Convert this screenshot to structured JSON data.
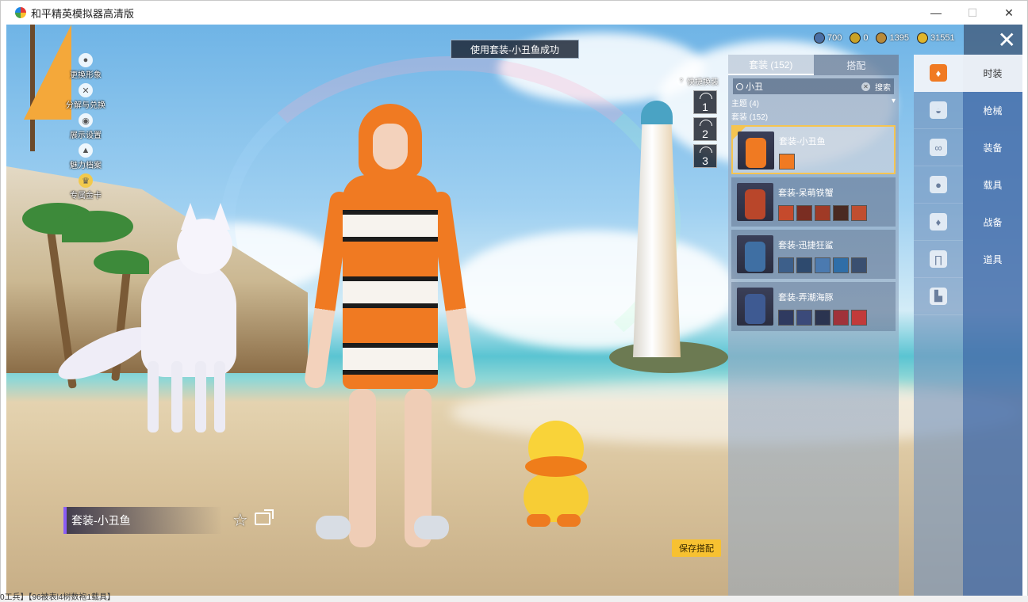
{
  "window": {
    "title": "和平精英模拟器高清版",
    "minimize": "—",
    "maximize": "☐",
    "close": "✕"
  },
  "toast": "使用套装-小丑鱼成功",
  "left_menu": [
    {
      "label": "更换形象",
      "icon": "person-icon"
    },
    {
      "label": "分解与兑换",
      "icon": "exchange-icon"
    },
    {
      "label": "展示设置",
      "icon": "eye-icon"
    },
    {
      "label": "魅力档案",
      "icon": "fire-icon"
    },
    {
      "label": "专属金卡",
      "icon": "crown-icon"
    }
  ],
  "currency": [
    {
      "value": "700",
      "color": "#4a6fa5"
    },
    {
      "value": "0",
      "color": "#c9a227"
    },
    {
      "value": "1395",
      "color": "#b88a3a"
    },
    {
      "value": "31551",
      "color": "#e0b52a"
    }
  ],
  "quick_swap": {
    "title": "快捷换装",
    "slots": [
      "1",
      "2",
      "3"
    ]
  },
  "panel": {
    "tabs": [
      {
        "label": "套装 (152)",
        "active": true
      },
      {
        "label": "搭配",
        "active": false
      }
    ],
    "search": {
      "value": "小丑",
      "button": "搜索"
    },
    "theme_row": "主题 (4)",
    "suit_row": "套装 (152)",
    "items": [
      {
        "name": "套装-小丑鱼",
        "selected": true,
        "color": "#f07a22",
        "parts": 1
      },
      {
        "name": "套装-呆萌铁蟹",
        "selected": false,
        "color": "#b9462a",
        "parts": 5
      },
      {
        "name": "套装-迅捷狂鲨",
        "selected": false,
        "color": "#3f6fa3",
        "parts": 5
      },
      {
        "name": "套装-弄潮海豚",
        "selected": false,
        "color": "#3e5a92",
        "parts": 5
      }
    ]
  },
  "categories": [
    "shirt-icon",
    "cap-icon",
    "glasses-icon",
    "mask-icon",
    "jacket-icon",
    "pants-icon",
    "shoes-icon"
  ],
  "nav": [
    "时装",
    "枪械",
    "装备",
    "载具",
    "战备",
    "道具"
  ],
  "outfit_name": "套装-小丑鱼",
  "save_button": "保存搭配",
  "bottom_text": "0工兵】【96被表l4树数袍1载具】"
}
